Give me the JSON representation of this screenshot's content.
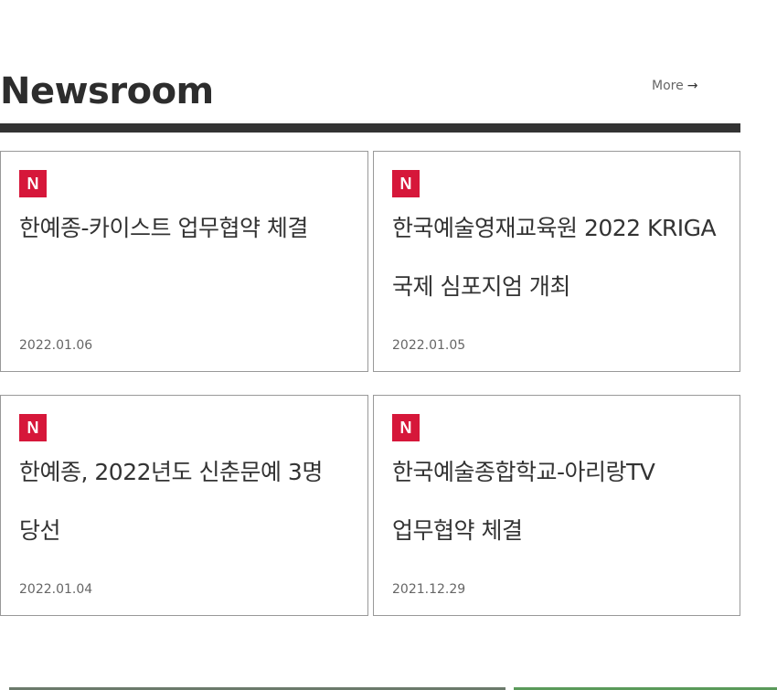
{
  "header": {
    "title": "Newsroom",
    "more_label": "More",
    "more_icon": "arrow-right-icon"
  },
  "accent_color": "#d6173a",
  "news": [
    {
      "badge": "N",
      "title": "한예종-카이스트 업무협약 체결",
      "date": "2022.01.06"
    },
    {
      "badge": "N",
      "title": "한국예술영재교육원 2022 KRIGA 국제 심포지엄 개최",
      "date": "2022.01.05"
    },
    {
      "badge": "N",
      "title": "한예종, 2022년도 신춘문예 3명 당선",
      "date": "2022.01.04"
    },
    {
      "badge": "N",
      "title": "한국예술종합학교-아리랑TV 업무협약 체결",
      "date": "2021.12.29"
    }
  ]
}
